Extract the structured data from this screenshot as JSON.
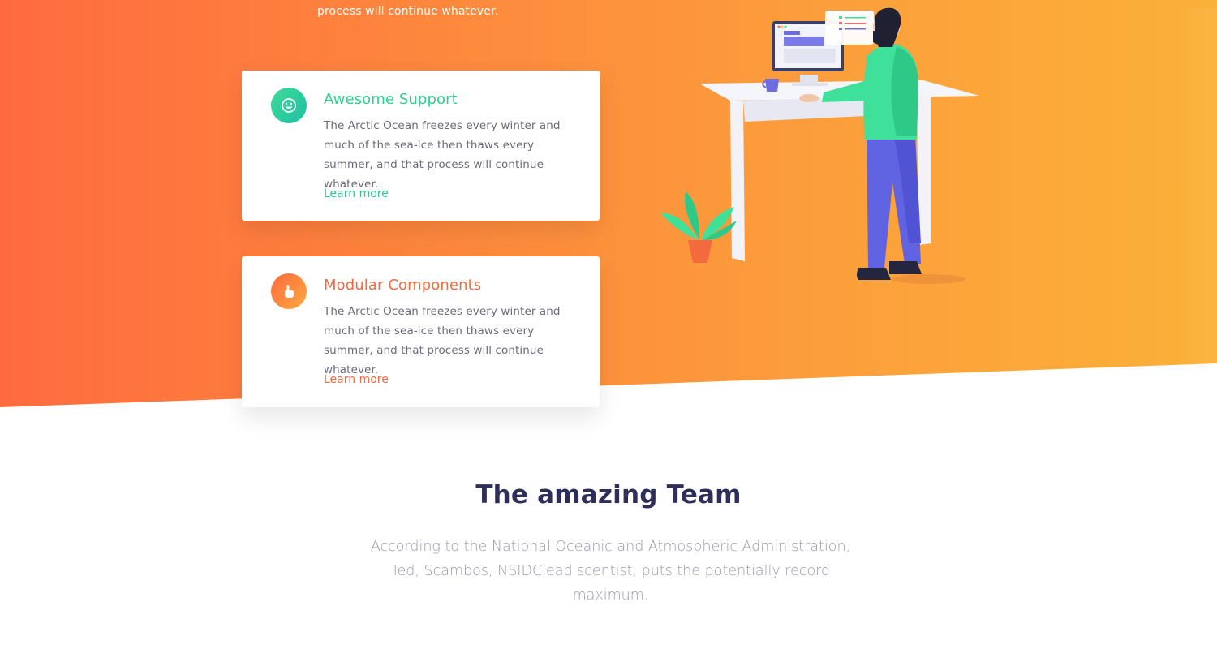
{
  "hero": {
    "top_text": "process will continue whatever."
  },
  "features": [
    {
      "title": "Awesome Support",
      "text": "The Arctic Ocean freezes every winter and much of the sea-ice then thaws every summer, and that process will continue whatever.",
      "link": "Learn more",
      "icon": "smile-icon",
      "color": "#2fd08e"
    },
    {
      "title": "Modular Components",
      "text": "The Arctic Ocean freezes every winter and much of the sea-ice then thaws every summer, and that process will continue whatever.",
      "link": "Learn more",
      "icon": "hand-pointer-icon",
      "color": "#f36a3e"
    }
  ],
  "team": {
    "title": "The amazing Team",
    "description": "According to the National Oceanic and Atmospheric Administration, Ted, Scambos, NSIDClead scentist, puts the potentially record maximum."
  },
  "colors": {
    "hero_gradient_start": "#ff6b3f",
    "hero_gradient_end": "#fbb038",
    "accent_green": "#2fd08e",
    "accent_orange": "#f36a3e",
    "heading": "#2e2e5a"
  }
}
